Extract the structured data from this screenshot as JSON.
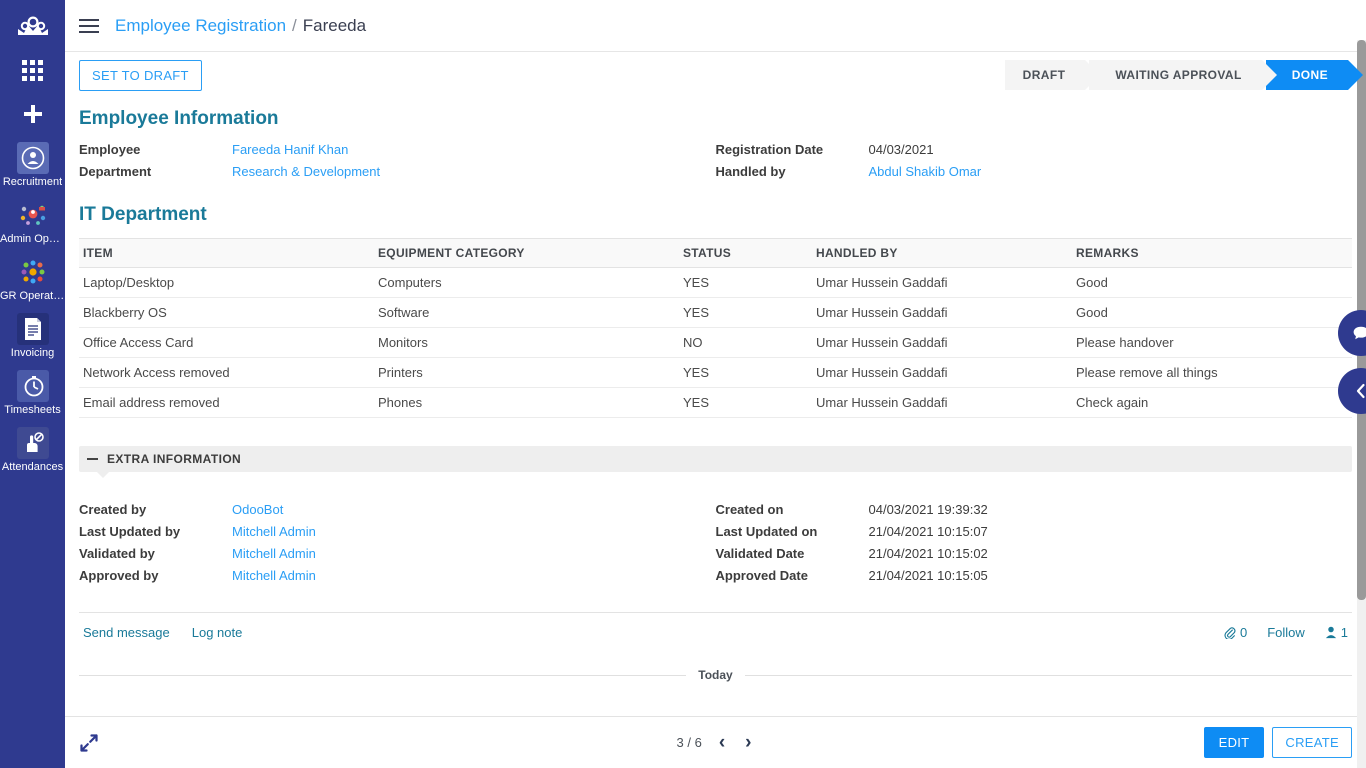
{
  "sidebar": {
    "logo": "odoo-logo",
    "apps_grid_icon": "apps-grid-icon",
    "plus_icon": "plus-icon",
    "items": [
      {
        "label": "Recruitment",
        "icon": "recruitment-icon"
      },
      {
        "label": "Admin Oper…",
        "icon": "admin-operations-icon"
      },
      {
        "label": "GR Operatio…",
        "icon": "gr-operations-icon"
      },
      {
        "label": "Invoicing",
        "icon": "invoicing-icon"
      },
      {
        "label": "Timesheets",
        "icon": "timesheets-icon"
      },
      {
        "label": "Attendances",
        "icon": "attendances-icon"
      }
    ]
  },
  "breadcrumb": {
    "menu_icon": "hamburger-icon",
    "root": "Employee Registration",
    "separator": "/",
    "current": "Fareeda"
  },
  "controlpanel": {
    "set_to_draft": "SET TO DRAFT",
    "statuses": [
      {
        "label": "DRAFT",
        "active": false
      },
      {
        "label": "WAITING APPROVAL",
        "active": false
      },
      {
        "label": "DONE",
        "active": true
      }
    ]
  },
  "employee_information": {
    "title": "Employee Information",
    "left": [
      {
        "label": "Employee",
        "value": "Fareeda Hanif Khan",
        "link": true
      },
      {
        "label": "Department",
        "value": "Research & Development",
        "link": true
      }
    ],
    "right": [
      {
        "label": "Registration Date",
        "value": "04/03/2021",
        "link": false
      },
      {
        "label": "Handled by",
        "value": "Abdul Shakib Omar",
        "link": true
      }
    ]
  },
  "it_department": {
    "title": "IT Department",
    "columns": [
      "ITEM",
      "EQUIPMENT CATEGORY",
      "STATUS",
      "HANDLED BY",
      "REMARKS"
    ],
    "rows": [
      [
        "Laptop/Desktop",
        "Computers",
        "YES",
        "Umar Hussein Gaddafi",
        "Good"
      ],
      [
        "Blackberry OS",
        "Software",
        "YES",
        "Umar Hussein Gaddafi",
        "Good"
      ],
      [
        "Office Access Card",
        "Monitors",
        "NO",
        "Umar Hussein Gaddafi",
        "Please handover"
      ],
      [
        "Network Access removed",
        "Printers",
        "YES",
        "Umar Hussein Gaddafi",
        "Please remove all things"
      ],
      [
        "Email address removed",
        "Phones",
        "YES",
        "Umar Hussein Gaddafi",
        "Check again"
      ]
    ]
  },
  "extra_information": {
    "title": "EXTRA INFORMATION",
    "collapse_icon": "minus-icon",
    "left": [
      {
        "label": "Created by",
        "value": "OdooBot",
        "link": true
      },
      {
        "label": "Last Updated by",
        "value": "Mitchell Admin",
        "link": true
      },
      {
        "label": "Validated by",
        "value": "Mitchell Admin",
        "link": true
      },
      {
        "label": "Approved by",
        "value": "Mitchell Admin",
        "link": true
      }
    ],
    "right": [
      {
        "label": "Created on",
        "value": "04/03/2021 19:39:32",
        "link": false
      },
      {
        "label": "Last Updated on",
        "value": "21/04/2021 10:15:07",
        "link": false
      },
      {
        "label": "Validated Date",
        "value": "21/04/2021 10:15:02",
        "link": false
      },
      {
        "label": "Approved Date",
        "value": "21/04/2021 10:15:05",
        "link": false
      }
    ]
  },
  "chatter": {
    "send_message": "Send message",
    "log_note": "Log note",
    "attachment_icon": "paperclip-icon",
    "attachment_count": "0",
    "follow": "Follow",
    "follower_icon": "user-icon",
    "follower_count": "1",
    "today_label": "Today"
  },
  "pager": {
    "expand_icon": "expand-icon",
    "count": "3 / 6",
    "prev_icon": "chevron-left-icon",
    "next_icon": "chevron-right-icon",
    "prev": "‹",
    "next": "›",
    "edit": "EDIT",
    "create": "CREATE"
  },
  "floating": {
    "chat_icon": "chat-bubble-icon",
    "panel_icon": "chevron-left-icon"
  },
  "colors": {
    "sidebar": "#2f3a8f",
    "accent_blue": "#0e8cf4",
    "link_blue": "#2a9ef5",
    "section_teal": "#1a7a99",
    "status_inactive": "#f4f4f4"
  }
}
